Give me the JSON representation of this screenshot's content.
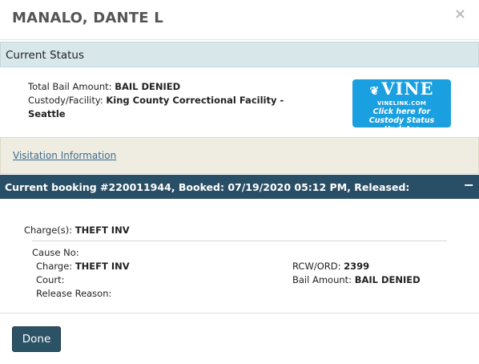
{
  "header": {
    "name": "MANALO, DANTE L",
    "close_glyph": "×"
  },
  "current_status": {
    "title": "Current Status",
    "total_bail_label": "Total Bail Amount:",
    "total_bail_value": "BAIL DENIED",
    "custody_label": "Custody/Facility:",
    "custody_value": "King County Correctional Facility - Seattle"
  },
  "vine": {
    "logo": "VINE",
    "site": "VINELINK.COM",
    "line1": "Click here for",
    "line2": "Custody Status Updates",
    "color": "#1a9fe0"
  },
  "visitation": {
    "link": "Visitation Information"
  },
  "booking": {
    "title": "Current booking #220011944, Booked: 07/19/2020 05:12 PM, Released:",
    "collapse_glyph": "−",
    "charges_label": "Charge(s):",
    "charges_value": "THEFT INV",
    "cause_no_label": "Cause No:",
    "charge_label": "Charge:",
    "charge_value": "THEFT INV",
    "court_label": "Court:",
    "release_reason_label": "Release Reason:",
    "rcw_label": "RCW/ORD:",
    "rcw_value": "2399",
    "bail_label": "Bail Amount:",
    "bail_value": "BAIL DENIED"
  },
  "footer": {
    "done_label": "Done"
  },
  "colors": {
    "status_bg": "#d7e7ea",
    "visit_bg": "#efede2",
    "booking_bg": "#294f66",
    "link": "#3d6a8c"
  }
}
